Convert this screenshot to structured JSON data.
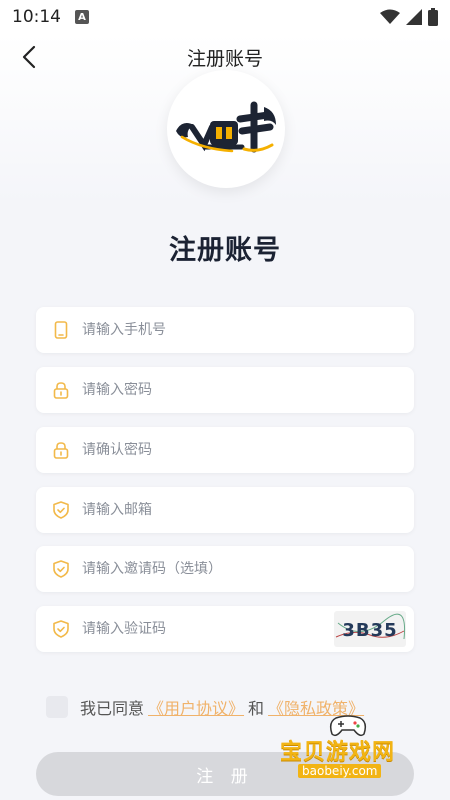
{
  "status_bar": {
    "time": "10:14",
    "notification_icon": "a-icon"
  },
  "nav": {
    "title": "注册账号",
    "back_icon": "chevron-left-icon"
  },
  "logo": {
    "name": "logo-image"
  },
  "page": {
    "heading": "注册账号"
  },
  "form": {
    "fields": [
      {
        "icon": "phone-icon",
        "placeholder": "请输入手机号"
      },
      {
        "icon": "lock-icon",
        "placeholder": "请输入密码"
      },
      {
        "icon": "lock-icon",
        "placeholder": "请确认密码"
      },
      {
        "icon": "shield-icon",
        "placeholder": "请输入邮箱"
      },
      {
        "icon": "shield-icon",
        "placeholder": "请输入邀请码（选填）"
      },
      {
        "icon": "shield-icon",
        "placeholder": "请输入验证码"
      }
    ],
    "captcha": "3B35"
  },
  "agreement": {
    "prefix": "我已同意",
    "user_agreement": "《用户协议》",
    "and": "和",
    "privacy_policy": "《隐私政策》"
  },
  "submit": {
    "label": "注 册"
  },
  "watermark": {
    "text": "宝贝游戏网",
    "url": "baobeiy.com"
  },
  "colors": {
    "accent": "#f0b26a",
    "icon": "#f2b94a",
    "button_disabled": "#d7d8dc"
  }
}
